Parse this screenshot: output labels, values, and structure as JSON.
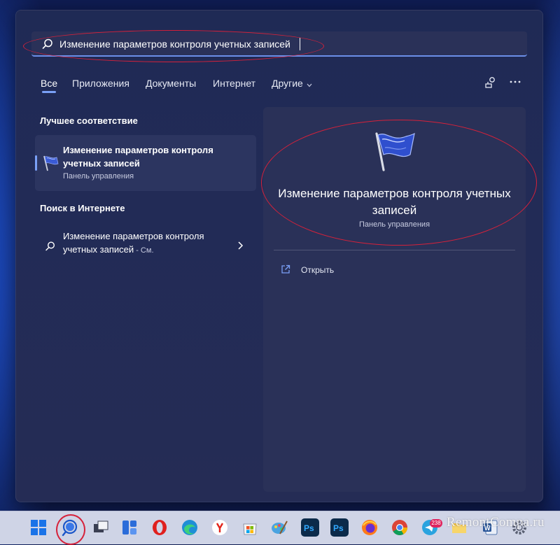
{
  "search": {
    "value": "Изменение параметров контроля учетных записей"
  },
  "tabs": [
    {
      "label": "Все"
    },
    {
      "label": "Приложения"
    },
    {
      "label": "Документы"
    },
    {
      "label": "Интернет"
    },
    {
      "label": "Другие"
    }
  ],
  "best_match": {
    "heading": "Лучшее соответствие",
    "title": "Изменение параметров контроля учетных записей",
    "subtitle": "Панель управления"
  },
  "web_search": {
    "heading": "Поиск в Интернете",
    "text": "Изменение параметров контроля учетных записей",
    "suffix": " - См."
  },
  "details": {
    "title": "Изменение параметров контроля учетных записей",
    "subtitle": "Панель управления",
    "open_label": "Открыть"
  },
  "taskbar": {
    "telegram_badge": "238",
    "watermark": "RemontCompa.ru"
  },
  "colors": {
    "accent": "#7aa0f7",
    "annotation": "#d6213a",
    "panel": "#222b56"
  }
}
